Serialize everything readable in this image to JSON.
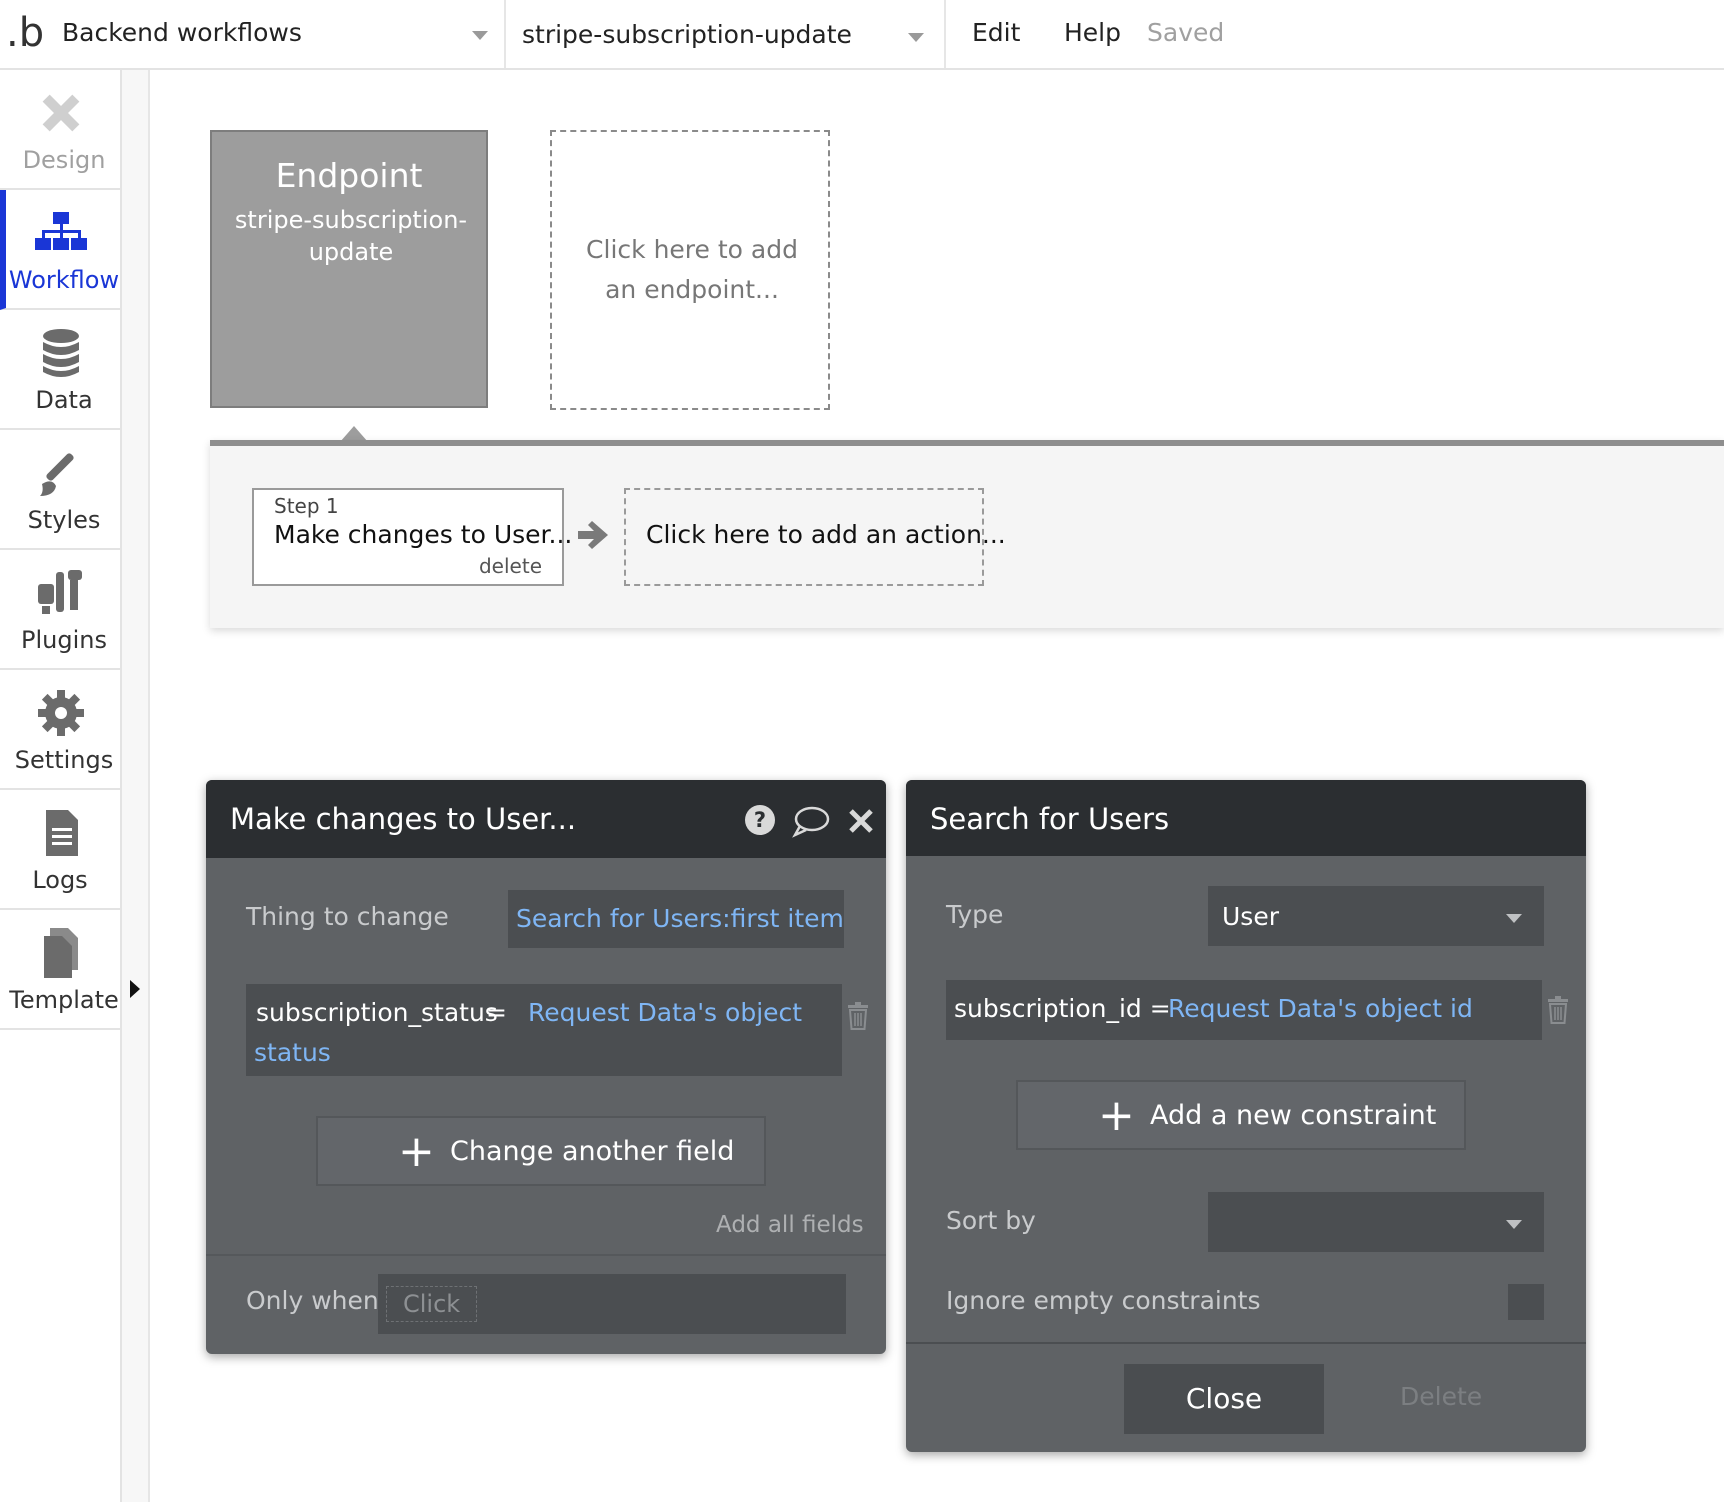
{
  "topbar": {
    "logo": ".b",
    "page_selector": "Backend workflows",
    "workflow_selector": "stripe-subscription-update",
    "menu": [
      "Edit",
      "Help"
    ],
    "status": "Saved"
  },
  "sidebar": {
    "items": [
      {
        "label": "Design",
        "icon": "design-icon"
      },
      {
        "label": "Workflow",
        "icon": "workflow-icon",
        "active": true
      },
      {
        "label": "Data",
        "icon": "database-icon"
      },
      {
        "label": "Styles",
        "icon": "brush-icon"
      },
      {
        "label": "Plugins",
        "icon": "plugin-icon"
      },
      {
        "label": "Settings",
        "icon": "gear-icon"
      },
      {
        "label": "Logs",
        "icon": "document-icon"
      },
      {
        "label": "Template",
        "icon": "template-icon"
      }
    ]
  },
  "canvas": {
    "endpoint": {
      "title": "Endpoint",
      "name": "stripe-subscription-update"
    },
    "add_endpoint": "Click here to add an endpoint...",
    "step1": {
      "number": "Step 1",
      "name": "Make changes to User...",
      "delete": "delete"
    },
    "add_action": "Click here to add an action..."
  },
  "make_changes_panel": {
    "title": "Make changes to User...",
    "icons": [
      "help-icon",
      "comment-icon",
      "close-icon"
    ],
    "thing_to_change_label": "Thing to change",
    "thing_to_change_value": "Search for Users:first item",
    "field_name": "subscription_status",
    "field_operator": "=",
    "field_value_line1": "Request Data's object",
    "field_value_line2": "status",
    "change_another_field": "Change another field",
    "add_all_fields": "Add all fields",
    "only_when_label": "Only when",
    "only_when_placeholder": "Click"
  },
  "search_panel": {
    "title": "Search for Users",
    "type_label": "Type",
    "type_value": "User",
    "constraint_field": "subscription_id =",
    "constraint_value": "Request Data's object id",
    "add_constraint": "Add a new constraint",
    "sort_by_label": "Sort by",
    "sort_by_value": "",
    "ignore_empty_label": "Ignore empty constraints",
    "ignore_empty_checked": false,
    "close": "Close",
    "delete": "Delete"
  },
  "colors": {
    "accent": "#1a36d6",
    "panel_bg": "#5f6265",
    "panel_header": "#2b2e31",
    "dynamic_text": "#7fb6f5"
  }
}
